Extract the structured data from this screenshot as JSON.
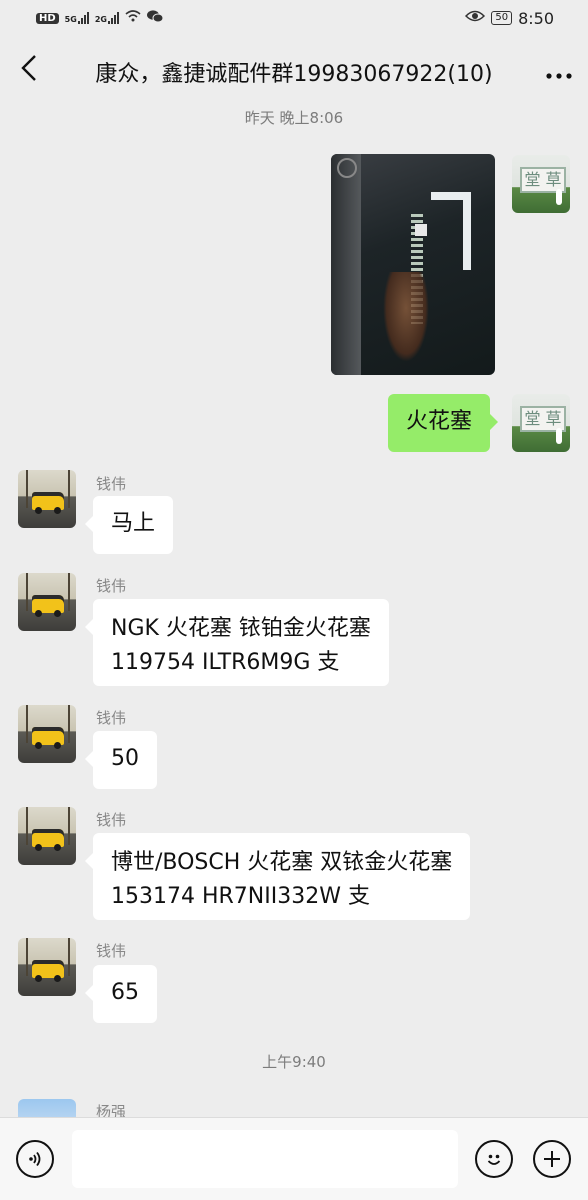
{
  "status_bar": {
    "hd": "HD",
    "net1": "5G",
    "net2": "2G",
    "battery": "50",
    "time": "8:50"
  },
  "header": {
    "back_icon": "chevron-left-icon",
    "title": "康众，鑫捷诚配件群19983067922(10)",
    "more_icon": "more-icon"
  },
  "timestamps": [
    "昨天 晚上8:06",
    "上午9:40"
  ],
  "messages": [
    {
      "sender": "self",
      "type": "image",
      "content": "photo-windshield-vin"
    },
    {
      "sender": "self",
      "type": "text",
      "content": "火花塞"
    },
    {
      "sender": "钱伟",
      "type": "text",
      "content": "马上"
    },
    {
      "sender": "钱伟",
      "type": "text",
      "lines": [
        "NGK 火花塞 铱铂金火花塞",
        "119754 ILTR6M9G 支"
      ]
    },
    {
      "sender": "钱伟",
      "type": "text",
      "content": "50"
    },
    {
      "sender": "钱伟",
      "type": "text",
      "lines": [
        "博世/BOSCH 火花塞 双铱金火花塞",
        "153174 HR7NII332W 支"
      ]
    },
    {
      "sender": "钱伟",
      "type": "text",
      "content": "65"
    },
    {
      "sender": "杨强",
      "type": "partial"
    }
  ],
  "avatar_self": {
    "sign_text": "堂 草"
  },
  "input_bar": {
    "voice_icon": "voice-icon",
    "emoji_icon": "emoji-icon",
    "plus_icon": "plus-icon",
    "placeholder": ""
  },
  "colors": {
    "background": "#ededed",
    "self_bubble": "#95ec69",
    "other_bubble": "#ffffff"
  }
}
